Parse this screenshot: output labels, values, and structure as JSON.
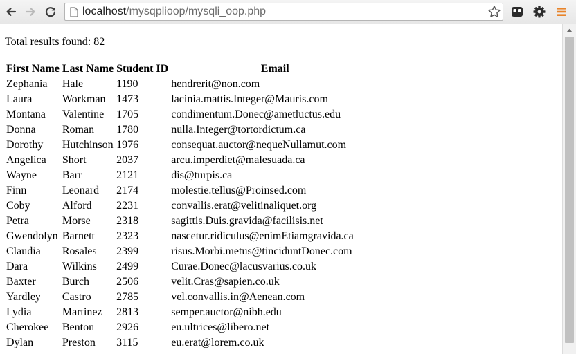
{
  "browser": {
    "url_host": "localhost",
    "url_path": "/mysqplioop/mysqli_oop.php"
  },
  "page": {
    "total_label": "Total results found: 82"
  },
  "table": {
    "headers": [
      "First Name",
      "Last Name",
      "Student ID",
      "Email"
    ],
    "rows": [
      [
        "Zephania",
        "Hale",
        "1190",
        "hendrerit@non.com"
      ],
      [
        "Laura",
        "Workman",
        "1473",
        "lacinia.mattis.Integer@Mauris.com"
      ],
      [
        "Montana",
        "Valentine",
        "1705",
        "condimentum.Donec@ametluctus.edu"
      ],
      [
        "Donna",
        "Roman",
        "1780",
        "nulla.Integer@tortordictum.ca"
      ],
      [
        "Dorothy",
        "Hutchinson",
        "1976",
        "consequat.auctor@nequeNullamut.com"
      ],
      [
        "Angelica",
        "Short",
        "2037",
        "arcu.imperdiet@malesuada.ca"
      ],
      [
        "Wayne",
        "Barr",
        "2121",
        "dis@turpis.ca"
      ],
      [
        "Finn",
        "Leonard",
        "2174",
        "molestie.tellus@Proinsed.com"
      ],
      [
        "Coby",
        "Alford",
        "2231",
        "convallis.erat@velitinaliquet.org"
      ],
      [
        "Petra",
        "Morse",
        "2318",
        "sagittis.Duis.gravida@facilisis.net"
      ],
      [
        "Gwendolyn",
        "Barnett",
        "2323",
        "nascetur.ridiculus@enimEtiamgravida.ca"
      ],
      [
        "Claudia",
        "Rosales",
        "2399",
        "risus.Morbi.metus@tinciduntDonec.com"
      ],
      [
        "Dara",
        "Wilkins",
        "2499",
        "Curae.Donec@lacusvarius.co.uk"
      ],
      [
        "Baxter",
        "Burch",
        "2506",
        "velit.Cras@sapien.co.uk"
      ],
      [
        "Yardley",
        "Castro",
        "2785",
        "vel.convallis.in@Aenean.com"
      ],
      [
        "Lydia",
        "Martinez",
        "2813",
        "semper.auctor@nibh.edu"
      ],
      [
        "Cherokee",
        "Benton",
        "2926",
        "eu.ultrices@libero.net"
      ],
      [
        "Dylan",
        "Preston",
        "3115",
        "eu.erat@lorem.co.uk"
      ]
    ]
  },
  "icons": {
    "back": "arrow-left-icon",
    "forward": "arrow-right-icon",
    "reload": "reload-icon",
    "page": "page-icon",
    "bookmark": "star-icon",
    "extension": "extension-icon",
    "settings": "gear-icon",
    "menu": "hamburger-menu-icon"
  },
  "colors": {
    "menu_accent": "#e8842a",
    "forward_disabled": "#b9b9b9"
  }
}
